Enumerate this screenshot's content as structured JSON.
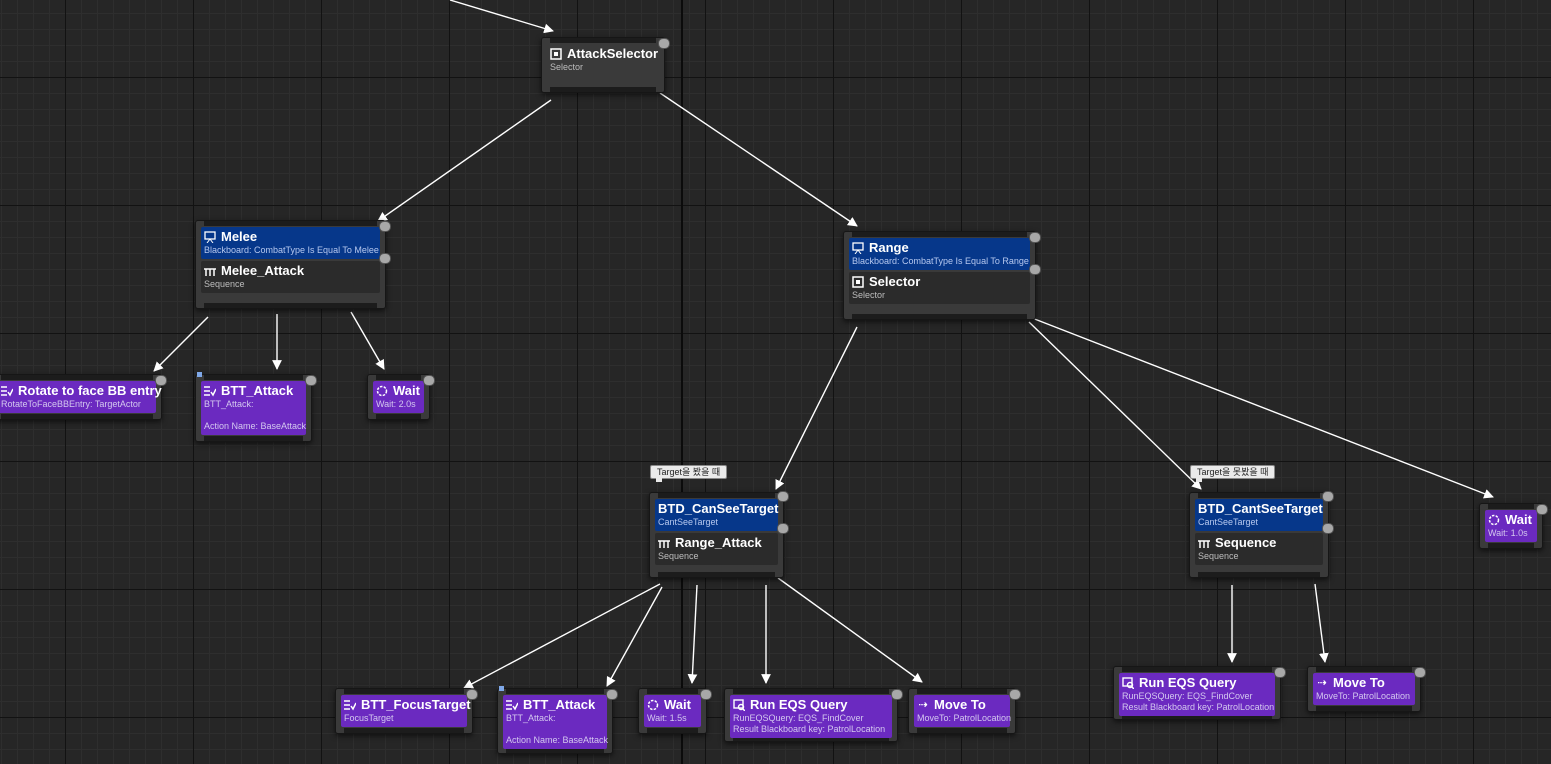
{
  "nodes": {
    "attack_selector": {
      "title": "AttackSelector",
      "subtitle": "Selector"
    },
    "melee": {
      "decorator": {
        "title": "Melee",
        "subtitle": "Blackboard: CombatType Is Equal To Melee"
      },
      "composite": {
        "title": "Melee_Attack",
        "subtitle": "Sequence"
      }
    },
    "range": {
      "decorator": {
        "title": "Range",
        "subtitle": "Blackboard: CombatType Is Equal To Range"
      },
      "composite": {
        "title": "Selector",
        "subtitle": "Selector"
      }
    },
    "rotate": {
      "title": "Rotate to face BB entry",
      "subtitle": "RotateToFaceBBEntry: TargetActor"
    },
    "melee_attack_task": {
      "title": "BTT_Attack",
      "subtitle": "BTT_Attack:",
      "detail": "Action Name: BaseAttack"
    },
    "melee_wait": {
      "title": "Wait",
      "subtitle": "Wait: 2.0s"
    },
    "can_see": {
      "comment": "Target을 봤을 때",
      "decorator": {
        "title": "BTD_CanSeeTarget",
        "subtitle": "CantSeeTarget"
      },
      "composite": {
        "title": "Range_Attack",
        "subtitle": "Sequence"
      }
    },
    "cant_see": {
      "comment": "Target을 못봤을 때",
      "decorator": {
        "title": "BTD_CantSeeTarget",
        "subtitle": "CantSeeTarget"
      },
      "composite": {
        "title": "Sequence",
        "subtitle": "Sequence"
      }
    },
    "range_wait": {
      "title": "Wait",
      "subtitle": "Wait: 1.0s"
    },
    "focus": {
      "title": "BTT_FocusTarget",
      "subtitle": "FocusTarget"
    },
    "ra_attack": {
      "title": "BTT_Attack",
      "subtitle": "BTT_Attack:",
      "detail": "Action Name: BaseAttack"
    },
    "ra_wait": {
      "title": "Wait",
      "subtitle": "Wait: 1.5s"
    },
    "ra_eqs": {
      "title": "Run EQS Query",
      "subtitle": "RunEQSQuery: EQS_FindCover",
      "detail": "Result Blackboard key: PatrolLocation"
    },
    "ra_move": {
      "title": "Move To",
      "subtitle": "MoveTo: PatrolLocation"
    },
    "cs_eqs": {
      "title": "Run EQS Query",
      "subtitle": "RunEQSQuery: EQS_FindCover",
      "detail": "Result Blackboard key: PatrolLocation"
    },
    "cs_move": {
      "title": "Move To",
      "subtitle": "MoveTo: PatrolLocation"
    }
  },
  "icons": {
    "selector": "selector-icon",
    "sequence": "sequence-icon",
    "blackboard": "blackboard-icon",
    "task": "task-icon",
    "wait": "wait-icon",
    "eqs": "eqs-query-icon",
    "move": "move-to-icon"
  },
  "colors": {
    "background": "#262626",
    "decorator": "#06378a",
    "task": "#6b2ac0",
    "composite": "#2b2b2b",
    "edge": "#ffffff"
  }
}
